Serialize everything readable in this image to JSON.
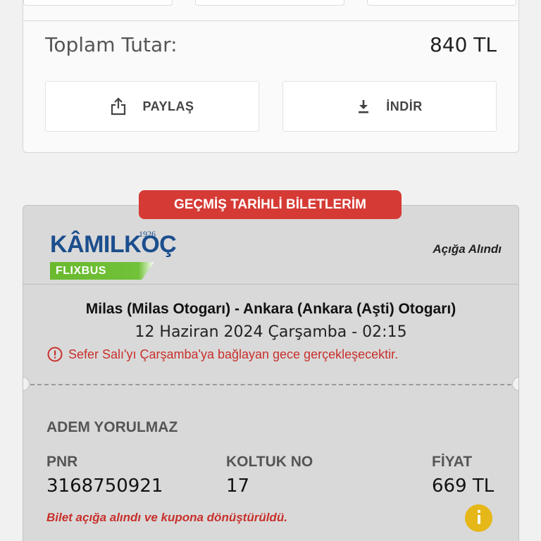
{
  "summary": {
    "total_label": "Toplam Tutar:",
    "total_value": "840 TL",
    "share_label": "PAYLAŞ",
    "download_label": "İNDİR"
  },
  "past_tickets": {
    "badge": "GEÇMİŞ TARİHLİ BİLETLERİM",
    "logo": {
      "word": "KÂMILKOÇ",
      "year": "1926",
      "sub": "FLIXBUS"
    },
    "status": "Açığa Alındı",
    "route": "Milas (Milas Otogarı) - Ankara (Ankara (Aşti) Otogarı)",
    "date": "12 Haziran 2024 Çarşamba - 02:15",
    "warning": "Sefer Salı'yı Çarşamba'ya bağlayan gece gerçekleşecektir.",
    "passenger": "ADEM YORULMAZ",
    "pnr_label": "PNR",
    "pnr_value": "3168750921",
    "seat_label": "KOLTUK NO",
    "seat_value": "17",
    "price_label": "FİYAT",
    "price_value": "669 TL",
    "note": "Bilet açığa alındı ve kupona dönüştürüldü."
  },
  "colors": {
    "accent_red": "#d63a35",
    "warning_red": "#c8302c",
    "brand_blue": "#1b4e8d",
    "brand_green": "#6ab92e",
    "info_yellow": "#e5b718"
  },
  "icons": [
    "share-icon",
    "download-icon",
    "alert-circle-icon",
    "info-icon"
  ]
}
